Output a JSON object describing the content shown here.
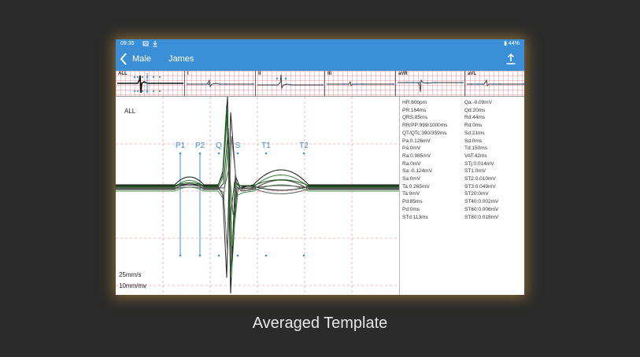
{
  "status_bar": {
    "time": "09:35",
    "icons": [
      "image-icon",
      "download-icon"
    ],
    "battery": "44%"
  },
  "app_bar": {
    "back_icon": "chevron-left-icon",
    "gender": "Male",
    "patient_name": "James",
    "share_icon": "share-icon"
  },
  "leads": [
    {
      "label": "ALL"
    },
    {
      "label": "I"
    },
    {
      "label": "II"
    },
    {
      "label": "III"
    },
    {
      "label": "aVR"
    },
    {
      "label": "aVL"
    }
  ],
  "main_view": {
    "lead_label": "ALL",
    "markers": [
      "P1",
      "P2",
      "Q",
      "S",
      "T1",
      "T2"
    ],
    "speed": "25mm/s",
    "gain": "10mm/mv"
  },
  "params_left": [
    "HR:60bpm",
    "PR:164ms",
    "QRS:85ms",
    "RR/PP:999/1000ms",
    "QT/QTc:390/359ms",
    "Pa:0.126mV",
    "Pa:0mV",
    "Ra:0.985mV",
    "Ra:0mV",
    "Sa:-0.124mV",
    "Sa:0mV",
    "Ta:0.265mV",
    "Ta:0mV",
    "Pd:85ms",
    "Pd:0ms",
    "STd:113ms"
  ],
  "params_right": [
    "Qa:-0.09mV",
    "Qd:20ms",
    "Rd:44ms",
    "Rd:0ms",
    "Sd:21ms",
    "Sd:0ms",
    "Td:150ms",
    "VAT:42ms",
    "STj:0.014mV",
    "ST1:0mV",
    "ST2:0.010mV",
    "ST3:0.049mV",
    "ST20:0mV",
    "ST40:0.002mV",
    "ST60:0.006mV",
    "ST80:0.018mV"
  ],
  "caption": "Averaged Template",
  "colors": {
    "background": "#2b2b2b",
    "app_bar": "#3a8fd6",
    "marker": "#3a8fd6",
    "grid": "#f4a0a8",
    "glow": "#d69c40"
  }
}
